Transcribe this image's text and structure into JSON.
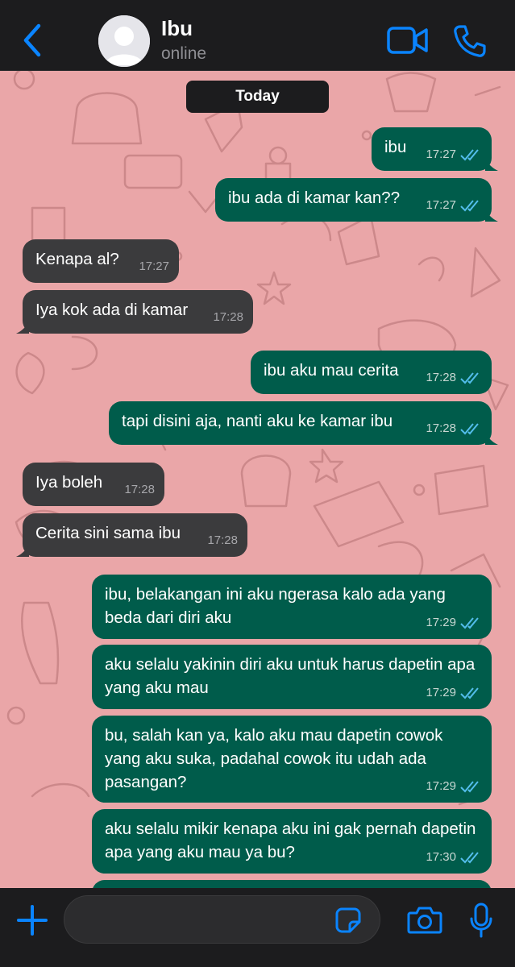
{
  "header": {
    "contact_name": "Ibu",
    "status": "online",
    "accent_color": "#0a84ff"
  },
  "chat": {
    "date_label": "Today",
    "background_color": "#eaa6a8",
    "messages": [
      {
        "direction": "outgoing",
        "text": "ibu",
        "time": "17:27",
        "read": true
      },
      {
        "direction": "outgoing",
        "text": "ibu ada di kamar kan??",
        "time": "17:27",
        "read": true
      },
      {
        "direction": "incoming",
        "text": "Kenapa al?",
        "time": "17:27"
      },
      {
        "direction": "incoming",
        "text": "Iya kok ada di kamar",
        "time": "17:28"
      },
      {
        "direction": "outgoing",
        "text": "ibu aku mau cerita",
        "time": "17:28",
        "read": true
      },
      {
        "direction": "outgoing",
        "text": "tapi disini aja, nanti aku ke kamar ibu",
        "time": "17:28",
        "read": true
      },
      {
        "direction": "incoming",
        "text": "Iya boleh",
        "time": "17:28"
      },
      {
        "direction": "incoming",
        "text": "Cerita sini sama ibu",
        "time": "17:28"
      },
      {
        "direction": "outgoing",
        "text": "ibu, belakangan ini aku ngerasa kalo ada yang beda dari diri aku",
        "time": "17:29",
        "read": true
      },
      {
        "direction": "outgoing",
        "text": "aku selalu yakinin diri aku untuk harus dapetin apa yang aku mau",
        "time": "17:29",
        "read": true
      },
      {
        "direction": "outgoing",
        "text": "bu, salah kan ya, kalo aku mau dapetin cowok yang aku suka, padahal cowok itu udah ada pasangan?",
        "time": "17:29",
        "read": true
      },
      {
        "direction": "outgoing",
        "text": "aku selalu mikir kenapa aku ini gak pernah dapetin apa yang aku mau ya bu?",
        "time": "17:30",
        "read": true
      }
    ]
  },
  "input_bar": {
    "message_value": "",
    "icons": [
      "plus-icon",
      "sticker-icon",
      "camera-icon",
      "microphone-icon"
    ]
  }
}
